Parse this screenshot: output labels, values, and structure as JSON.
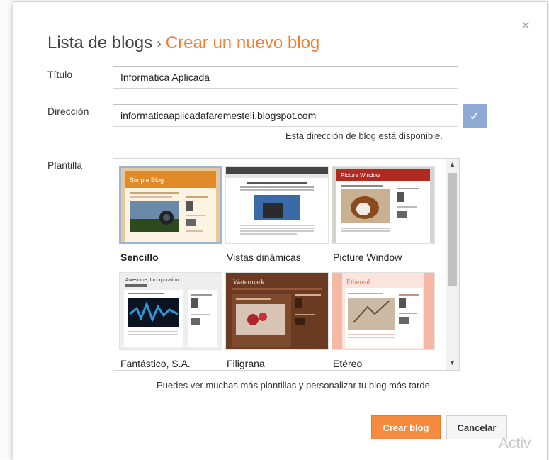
{
  "dialog": {
    "breadcrumb_root": "Lista de blogs",
    "breadcrumb_separator": "›",
    "breadcrumb_current": "Crear un nuevo blog",
    "close_glyph": "×"
  },
  "form": {
    "title_label": "Título",
    "title_value": "Informatica Aplicada",
    "address_label": "Dirección",
    "address_value": "informaticaaplicadafaremesteli.blogspot.com",
    "address_status": "Esta dirección de blog está disponible.",
    "check_glyph": "✓",
    "template_label": "Plantilla"
  },
  "templates": [
    {
      "name": "Sencillo",
      "selected": true,
      "bold": true
    },
    {
      "name": "Vistas dinámicas",
      "selected": false,
      "bold": false
    },
    {
      "name": "Picture Window",
      "selected": false,
      "bold": false
    },
    {
      "name": "Fantástico, S.A.",
      "selected": false,
      "bold": false
    },
    {
      "name": "Filigrana",
      "selected": false,
      "bold": false
    },
    {
      "name": "Etéreo",
      "selected": false,
      "bold": false
    }
  ],
  "thumb_text": {
    "simple_header": "Simple Blog",
    "picture_header": "Picture Window",
    "awesome_header": "Awesome, Incorporation",
    "watermark_header": "Watermark",
    "ethereal_header": "Ethereal"
  },
  "scroll": {
    "up": "▲",
    "down": "▼"
  },
  "note": "Puedes ver muchas más plantillas y personalizar tu blog más tarde.",
  "buttons": {
    "create": "Crear blog",
    "cancel": "Cancelar"
  },
  "overlay": {
    "activate_text": "Activ"
  },
  "colors": {
    "accent": "#f57d30",
    "create_button": "#f68b3f",
    "check": "#8fa9d6"
  }
}
